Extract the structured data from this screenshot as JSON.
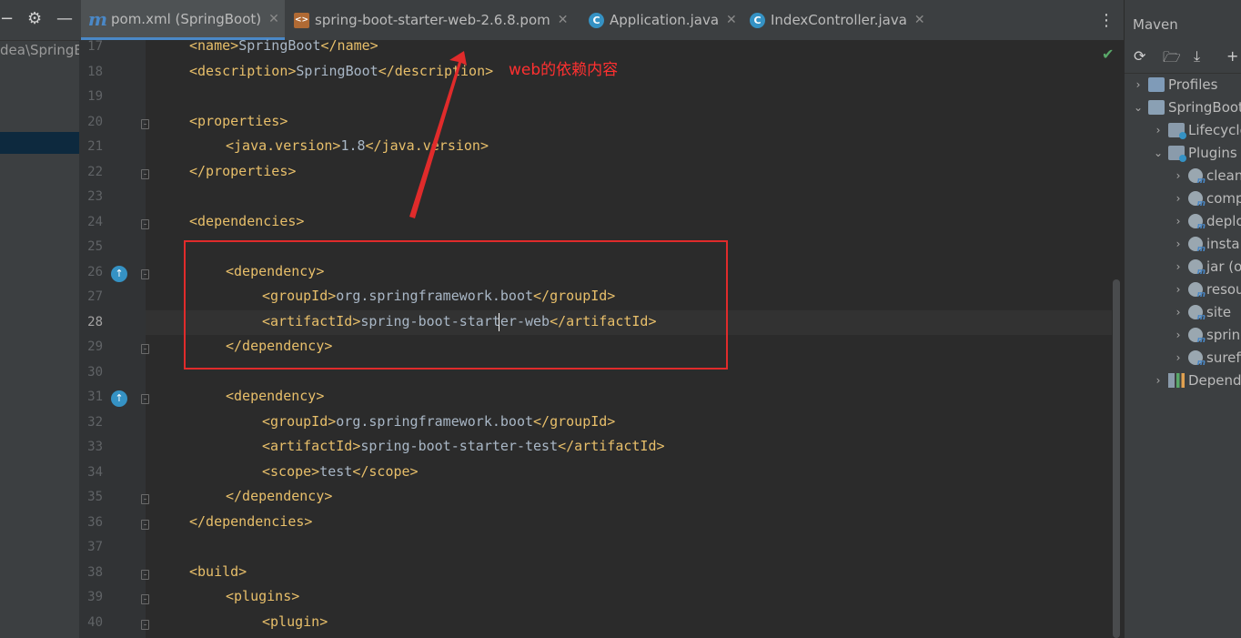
{
  "left_panel": {
    "path_fragment": "dea\\SpringB"
  },
  "tabs": [
    {
      "label": "pom.xml (SpringBoot)",
      "icon": "maven-m-icon",
      "active": true
    },
    {
      "label": "spring-boot-starter-web-2.6.8.pom",
      "icon": "pom-file-icon",
      "active": false
    },
    {
      "label": "Application.java",
      "icon": "spring-class-icon",
      "active": false
    },
    {
      "label": "IndexController.java",
      "icon": "class-c-icon",
      "active": false
    }
  ],
  "editor": {
    "current_line": 28,
    "lines": [
      {
        "n": "17",
        "indent": 1,
        "parts": [
          [
            "tag",
            "<name>"
          ],
          [
            "txt",
            "SpringBoot"
          ],
          [
            "tag",
            "</name>"
          ]
        ]
      },
      {
        "n": "18",
        "indent": 1,
        "parts": [
          [
            "tag",
            "<description>"
          ],
          [
            "txt",
            "SpringBoot"
          ],
          [
            "tag",
            "</description>"
          ]
        ]
      },
      {
        "n": "19",
        "indent": 0,
        "parts": []
      },
      {
        "n": "20",
        "indent": 1,
        "parts": [
          [
            "tag",
            "<properties>"
          ]
        ]
      },
      {
        "n": "21",
        "indent": 2,
        "parts": [
          [
            "tag",
            "<java.version>"
          ],
          [
            "txt",
            "1.8"
          ],
          [
            "tag",
            "</java.version>"
          ]
        ]
      },
      {
        "n": "22",
        "indent": 1,
        "parts": [
          [
            "tag",
            "</properties>"
          ]
        ]
      },
      {
        "n": "23",
        "indent": 0,
        "parts": []
      },
      {
        "n": "24",
        "indent": 1,
        "parts": [
          [
            "tag",
            "<dependencies>"
          ]
        ]
      },
      {
        "n": "25",
        "indent": 0,
        "parts": []
      },
      {
        "n": "26",
        "indent": 2,
        "parts": [
          [
            "tag",
            "<dependency>"
          ]
        ]
      },
      {
        "n": "27",
        "indent": 3,
        "parts": [
          [
            "tag",
            "<groupId>"
          ],
          [
            "txt",
            "org.springframework.boot"
          ],
          [
            "tag",
            "</groupId>"
          ]
        ]
      },
      {
        "n": "28",
        "indent": 3,
        "parts": [
          [
            "tag",
            "<artifactId>"
          ],
          [
            "txt",
            "spring-boot-starter-web"
          ],
          [
            "tag",
            "</artifactId>"
          ]
        ]
      },
      {
        "n": "29",
        "indent": 2,
        "parts": [
          [
            "tag",
            "</dependency>"
          ]
        ]
      },
      {
        "n": "30",
        "indent": 0,
        "parts": []
      },
      {
        "n": "31",
        "indent": 2,
        "parts": [
          [
            "tag",
            "<dependency>"
          ]
        ]
      },
      {
        "n": "32",
        "indent": 3,
        "parts": [
          [
            "tag",
            "<groupId>"
          ],
          [
            "txt",
            "org.springframework.boot"
          ],
          [
            "tag",
            "</groupId>"
          ]
        ]
      },
      {
        "n": "33",
        "indent": 3,
        "parts": [
          [
            "tag",
            "<artifactId>"
          ],
          [
            "txt",
            "spring-boot-starter-test"
          ],
          [
            "tag",
            "</artifactId>"
          ]
        ]
      },
      {
        "n": "34",
        "indent": 3,
        "parts": [
          [
            "tag",
            "<scope>"
          ],
          [
            "txt",
            "test"
          ],
          [
            "tag",
            "</scope>"
          ]
        ]
      },
      {
        "n": "35",
        "indent": 2,
        "parts": [
          [
            "tag",
            "</dependency>"
          ]
        ]
      },
      {
        "n": "36",
        "indent": 1,
        "parts": [
          [
            "tag",
            "</dependencies>"
          ]
        ]
      },
      {
        "n": "37",
        "indent": 0,
        "parts": []
      },
      {
        "n": "38",
        "indent": 1,
        "parts": [
          [
            "tag",
            "<build>"
          ]
        ]
      },
      {
        "n": "39",
        "indent": 2,
        "parts": [
          [
            "tag",
            "<plugins>"
          ]
        ]
      },
      {
        "n": "40",
        "indent": 3,
        "parts": [
          [
            "tag",
            "<plugin>"
          ]
        ]
      }
    ]
  },
  "annotation": {
    "text": "web的依赖内容",
    "color": "#ff3030"
  },
  "maven": {
    "title": "Maven",
    "tree": [
      {
        "label": "Profiles",
        "level": 0,
        "chevron": "right",
        "icon": "profiles-icon"
      },
      {
        "label": "SpringBoot",
        "level": 0,
        "chevron": "down",
        "icon": "maven-project-icon"
      },
      {
        "label": "Lifecycle",
        "level": 1,
        "chevron": "right",
        "icon": "lifecycle-folder-icon"
      },
      {
        "label": "Plugins",
        "level": 1,
        "chevron": "down",
        "icon": "plugins-folder-icon"
      },
      {
        "label": "clean",
        "level": 2,
        "chevron": "right",
        "icon": "plugin-icon"
      },
      {
        "label": "compiler",
        "level": 2,
        "chevron": "right",
        "icon": "plugin-icon"
      },
      {
        "label": "deploy",
        "level": 2,
        "chevron": "right",
        "icon": "plugin-icon"
      },
      {
        "label": "install",
        "level": 2,
        "chevron": "right",
        "icon": "plugin-icon"
      },
      {
        "label": "jar (o",
        "level": 2,
        "chevron": "right",
        "icon": "plugin-icon"
      },
      {
        "label": "resources",
        "level": 2,
        "chevron": "right",
        "icon": "plugin-icon"
      },
      {
        "label": "site",
        "level": 2,
        "chevron": "right",
        "icon": "plugin-icon"
      },
      {
        "label": "spring-boot",
        "level": 2,
        "chevron": "right",
        "icon": "plugin-icon"
      },
      {
        "label": "surefire",
        "level": 2,
        "chevron": "right",
        "icon": "plugin-icon"
      },
      {
        "label": "Dependencies",
        "level": 1,
        "chevron": "right",
        "icon": "dependencies-icon"
      }
    ]
  }
}
